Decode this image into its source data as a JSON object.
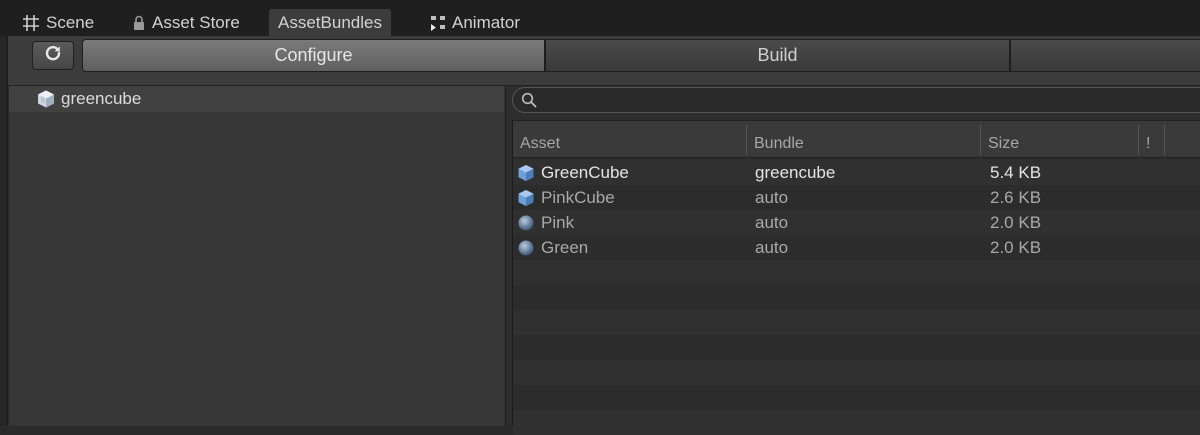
{
  "tabs": [
    {
      "label": "Scene",
      "icon": "grid-icon"
    },
    {
      "label": "Asset Store",
      "icon": "lock-icon"
    },
    {
      "label": "AssetBundles",
      "icon": ""
    },
    {
      "label": "Animator",
      "icon": "animator-icon"
    }
  ],
  "toolbar": {
    "refresh_icon": "refresh-icon",
    "configure_label": "Configure",
    "build_label": "Build"
  },
  "bundles": [
    {
      "name": "greencube",
      "icon": "cube-icon"
    }
  ],
  "search": {
    "value": "",
    "placeholder": ""
  },
  "table": {
    "headers": {
      "asset": "Asset",
      "bundle": "Bundle",
      "size": "Size",
      "warn": "!"
    },
    "rows": [
      {
        "asset": "GreenCube",
        "icon": "cube-icon",
        "bundle": "greencube",
        "size": "5.4 KB"
      },
      {
        "asset": "PinkCube",
        "icon": "cube-icon",
        "bundle": "auto",
        "size": "2.6 KB"
      },
      {
        "asset": "Pink",
        "icon": "sphere-icon",
        "bundle": "auto",
        "size": "2.0 KB"
      },
      {
        "asset": "Green",
        "icon": "sphere-icon",
        "bundle": "auto",
        "size": "2.0 KB"
      }
    ]
  },
  "colors": {
    "background": "#2b2b2b",
    "tab_active": "#3c3c3c",
    "configure_active": "#6e6e6e",
    "cube_blue": "#6b9bd8"
  }
}
